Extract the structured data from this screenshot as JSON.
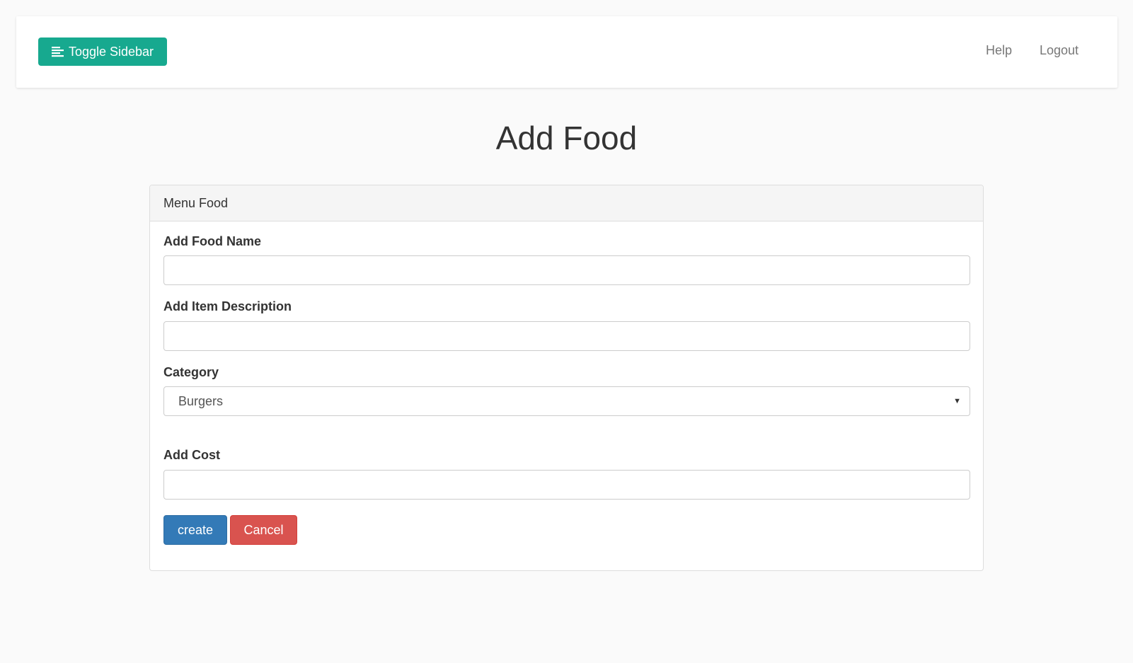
{
  "navbar": {
    "toggle_label": "Toggle Sidebar",
    "toggle_icon": "align-left-icon",
    "links": [
      {
        "label": "Help"
      },
      {
        "label": "Logout"
      }
    ]
  },
  "page": {
    "title": "Add Food"
  },
  "panel": {
    "heading": "Menu Food",
    "fields": {
      "food_name": {
        "label": "Add Food Name",
        "value": "",
        "placeholder": ""
      },
      "description": {
        "label": "Add Item Description",
        "value": "",
        "placeholder": ""
      },
      "category": {
        "label": "Category",
        "selected": "Burgers"
      },
      "cost": {
        "label": "Add Cost",
        "value": "",
        "placeholder": ""
      }
    },
    "buttons": {
      "create_label": "create",
      "cancel_label": "Cancel"
    }
  },
  "colors": {
    "toggle_bg": "#17a98f",
    "create_bg": "#337ab7",
    "cancel_bg": "#d9534f",
    "page_bg": "#fafafa"
  }
}
